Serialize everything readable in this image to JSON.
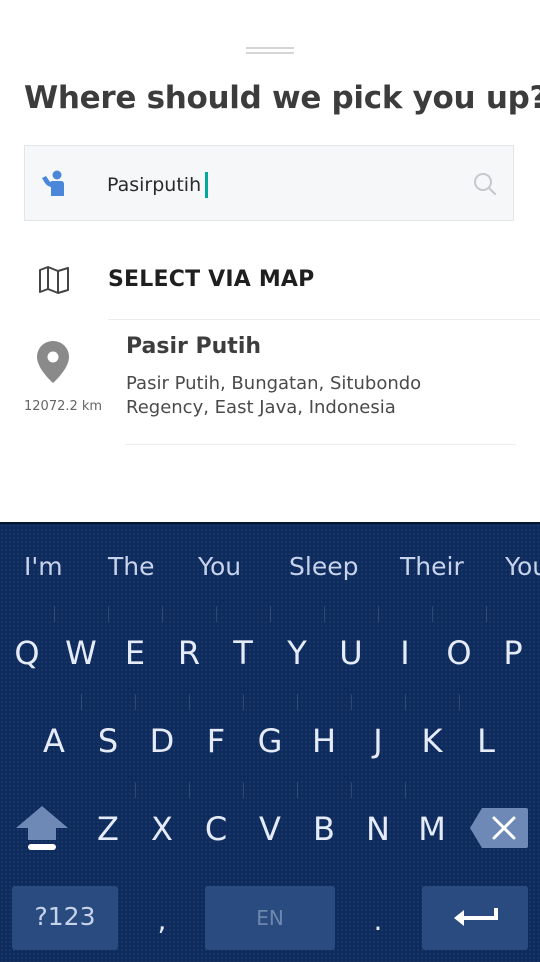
{
  "title": "Where should we pick you up?",
  "search": {
    "value": "Pasirputih"
  },
  "map_option": {
    "label": "SELECT VIA MAP"
  },
  "result": {
    "name": "Pasir Putih",
    "address": "Pasir Putih, Bungatan, Situbondo Regency, East Java, Indonesia",
    "distance": "12072.2 km"
  },
  "keyboard": {
    "suggestions": [
      "I'm",
      "The",
      "You",
      "Sleep",
      "Their",
      "You"
    ],
    "row1": [
      "Q",
      "W",
      "E",
      "R",
      "T",
      "Y",
      "U",
      "I",
      "O",
      "P"
    ],
    "row2": [
      "A",
      "S",
      "D",
      "F",
      "G",
      "H",
      "J",
      "K",
      "L"
    ],
    "row3": [
      "Z",
      "X",
      "C",
      "V",
      "B",
      "N",
      "M"
    ],
    "symbols_label": "?123",
    "comma": ",",
    "space_label": "EN",
    "period": "."
  },
  "colors": {
    "accent": "#00a89d",
    "person_icon": "#4a86d9",
    "keyboard_bg": "#0e2b5e"
  },
  "icons": {
    "person": "person-icon",
    "search": "search-icon",
    "map": "map-icon",
    "pin": "location-pin-icon",
    "shift": "shift-icon",
    "backspace": "backspace-icon",
    "enter": "enter-icon"
  }
}
